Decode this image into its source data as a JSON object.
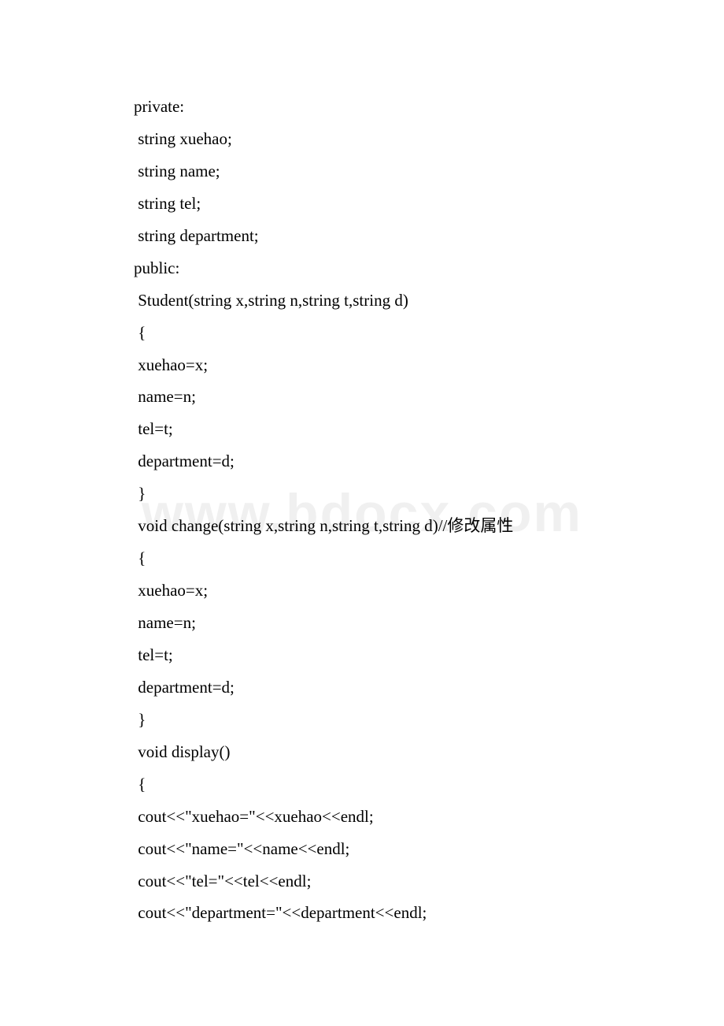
{
  "watermark": "www.bdocx.com",
  "code": {
    "lines": [
      "private:",
      " string xuehao;",
      " string name;",
      " string tel;",
      " string department;",
      "public:",
      " Student(string x,string n,string t,string d)",
      " {",
      " xuehao=x;",
      " name=n;",
      " tel=t;",
      " department=d;",
      " }",
      " void change(string x,string n,string t,string d)//修改属性",
      " {",
      " xuehao=x;",
      " name=n;",
      " tel=t;",
      " department=d;",
      " }",
      " void display()",
      " {",
      " cout<<\"xuehao=\"<<xuehao<<endl;",
      " cout<<\"name=\"<<name<<endl;",
      " cout<<\"tel=\"<<tel<<endl;",
      " cout<<\"department=\"<<department<<endl;"
    ]
  }
}
